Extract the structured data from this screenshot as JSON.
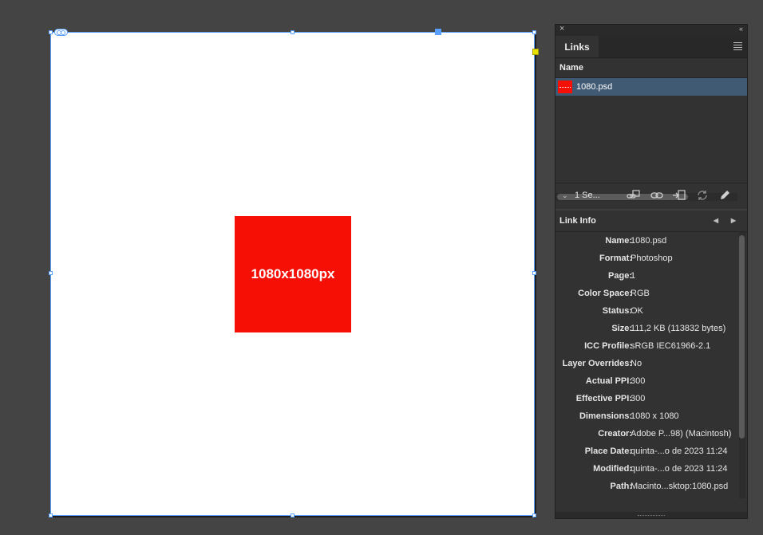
{
  "canvas": {
    "image_label": "1080x1080px",
    "image_color": "#f50f05"
  },
  "panel": {
    "tab_label": "Links",
    "close_glyph": "×",
    "collapse_glyph": "‹‹",
    "column_header": "Name",
    "links": [
      {
        "name": "1080.psd",
        "selected": true
      }
    ],
    "toolbar": {
      "selection_count": "1 Se...",
      "icons": [
        "relink-cc-icon",
        "relink-icon",
        "go-to-link-icon",
        "update-link-icon",
        "edit-original-icon"
      ]
    },
    "link_info": {
      "title": "Link Info",
      "rows": [
        {
          "key": "Name:",
          "value": "1080.psd"
        },
        {
          "key": "Format:",
          "value": "Photoshop"
        },
        {
          "key": "Page:",
          "value": "1"
        },
        {
          "key": "Color Space:",
          "value": "RGB"
        },
        {
          "key": "Status:",
          "value": "OK"
        },
        {
          "key": "Size:",
          "value": "111,2 KB (113832 bytes)"
        },
        {
          "key": "ICC Profile:",
          "value": "sRGB IEC61966-2.1"
        },
        {
          "key": "Layer Overrides:",
          "value": "No"
        },
        {
          "key": "Actual PPI:",
          "value": "300"
        },
        {
          "key": "Effective PPI:",
          "value": "300"
        },
        {
          "key": "Dimensions:",
          "value": "1080 x 1080"
        },
        {
          "key": "Creator:",
          "value": "Adobe P...98)  (Macintosh)"
        },
        {
          "key": "Place Date:",
          "value": "quinta-...o de 2023 11:24"
        },
        {
          "key": "Modified:",
          "value": "quinta-...o de 2023 11:24"
        },
        {
          "key": "Path:",
          "value": "Macinto...sktop:1080.psd"
        }
      ]
    }
  },
  "colors": {
    "background": "#444444",
    "panel": "#323232",
    "selection": "#415a74",
    "frame_edge": "#5aa0ff"
  }
}
